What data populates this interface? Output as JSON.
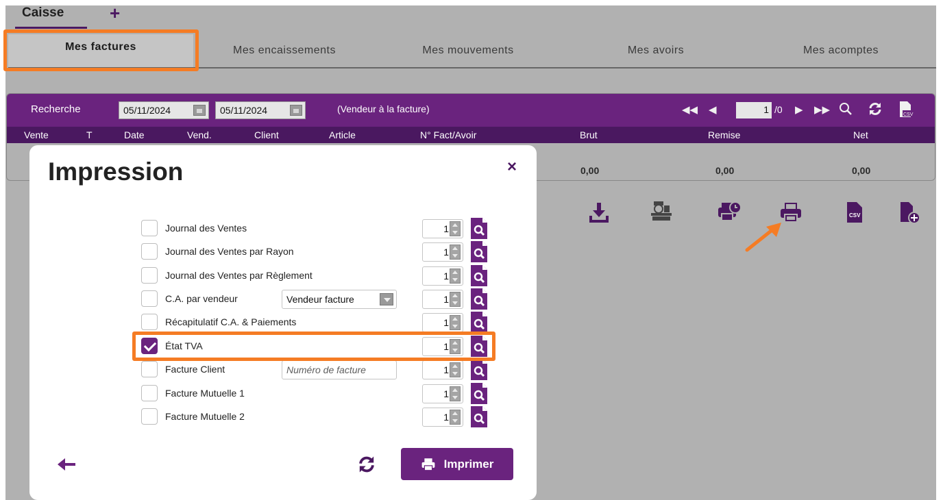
{
  "tabs": {
    "caisse": "Caisse",
    "add": "+"
  },
  "subtabs": [
    "Mes factures",
    "Mes encaissements",
    "Mes mouvements",
    "Mes avoirs",
    "Mes acomptes"
  ],
  "grid": {
    "search_label": "Recherche",
    "date_from": "05/11/2024",
    "date_to": "05/11/2024",
    "vendor_hint": "(Vendeur à la facture)",
    "page_current": "1",
    "page_total": "/0",
    "columns": [
      "Vente",
      "T",
      "Date",
      "Vend.",
      "Client",
      "Article",
      "N° Fact/Avoir",
      "Brut",
      "Remise",
      "Net"
    ],
    "totals": {
      "brut": "0,00",
      "remise": "0,00",
      "net": "0,00"
    }
  },
  "toolbar_icons": [
    "download-icon",
    "cash-register-icon",
    "scheduled-print-icon",
    "print-icon",
    "csv-icon",
    "add-file-icon"
  ],
  "modal": {
    "title": "Impression",
    "close": "×",
    "rows": [
      {
        "label": "Journal des Ventes",
        "checked": false,
        "qty": "1"
      },
      {
        "label": "Journal des Ventes par Rayon",
        "checked": false,
        "qty": "1"
      },
      {
        "label": "Journal des Ventes par Règlement",
        "checked": false,
        "qty": "1"
      },
      {
        "label": "C.A. par vendeur",
        "checked": false,
        "qty": "1",
        "select": "Vendeur facture"
      },
      {
        "label": "Récapitulatif C.A. & Paiements",
        "checked": false,
        "qty": "1"
      },
      {
        "label": "État TVA",
        "checked": true,
        "qty": "1"
      },
      {
        "label": "Facture Client",
        "checked": false,
        "qty": "1",
        "placeholder": "Numéro de facture"
      },
      {
        "label": "Facture Mutuelle 1",
        "checked": false,
        "qty": "1"
      },
      {
        "label": "Facture Mutuelle 2",
        "checked": false,
        "qty": "1"
      }
    ],
    "print_label": "Imprimer"
  },
  "colors": {
    "primary": "#6a237e",
    "header_dark": "#4a1860",
    "highlight": "#f57c24",
    "background": "#b1b1b1"
  }
}
